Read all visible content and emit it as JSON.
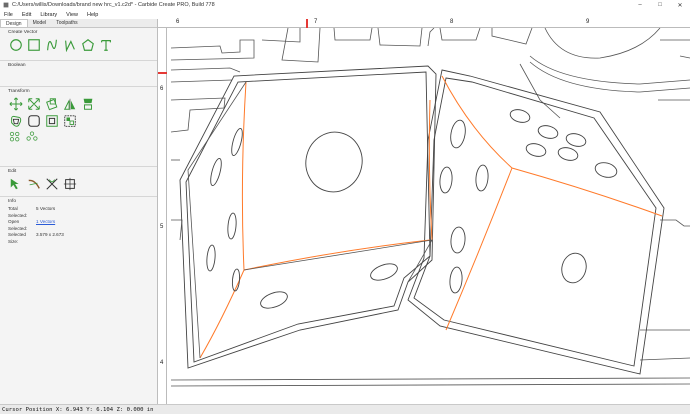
{
  "window": {
    "title": "C:/Users/willis/Downloads/brand new hrc_v1.c2d* - Carbide Create PRO, Build 778",
    "controls": [
      "–",
      "□",
      "✕"
    ]
  },
  "menu": [
    "File",
    "Edit",
    "Library",
    "View",
    "Help"
  ],
  "sidebar": {
    "tabs": [
      "Design",
      "Model",
      "Toolpaths"
    ],
    "active_tab": "Design",
    "sections": {
      "create_vector": "Create Vector",
      "boolean": "Boolean",
      "transform": "Transform",
      "edit": "Edit",
      "info": "Info"
    },
    "create_vector_icons": [
      "circle-icon",
      "rectangle-icon",
      "curve-icon",
      "polyline-icon",
      "polygon-icon",
      "text-icon"
    ],
    "transform_icons": [
      "move-icon",
      "scale-icon",
      "rotate-icon",
      "flip-icon",
      "align-icon",
      "offset-icon",
      "fillet-icon",
      "inset-icon",
      "group-icon",
      "ungroup-icon",
      "array-icon",
      "array-circular-icon"
    ],
    "edit_icons": [
      "node-edit-icon",
      "trim-icon",
      "cut-icon",
      "bbox-icon"
    ],
    "info": [
      {
        "key": "Total Selected:",
        "value": "5 Vectors",
        "link": false
      },
      {
        "key": "Open Selected:",
        "value": "1 Vectors",
        "link": true
      },
      {
        "key": "Selected Size:",
        "value": "3.579 x 2.673",
        "link": false
      }
    ],
    "accent_color": "#3a9a3a"
  },
  "ruler": {
    "top_labels": [
      "6",
      "7",
      "8",
      "9"
    ],
    "left_labels": [
      "6",
      "5",
      "4"
    ],
    "marker_color": "#e53935"
  },
  "status": {
    "text": "Cursor Position X: 6.943 Y: 6.104 Z: 0.000 in"
  },
  "canvas_colors": {
    "vector": "#444444",
    "selected": "#ff7a2a"
  }
}
